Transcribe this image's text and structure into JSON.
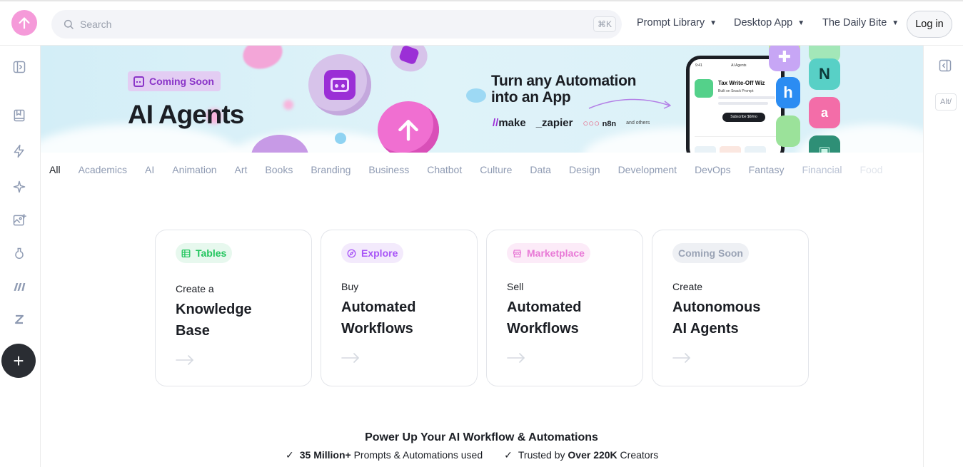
{
  "header": {
    "search_placeholder": "Search",
    "search_shortcut": "⌘K",
    "nav": [
      {
        "label": "Prompt Library"
      },
      {
        "label": "Desktop App"
      },
      {
        "label": "The Daily Bite"
      }
    ],
    "login_label": "Log in"
  },
  "right_sidebar": {
    "shortcut_badge": "Alt/"
  },
  "banner": {
    "badge": "Coming Soon",
    "title": "AI Agents",
    "tagline_line1": "Turn any Automation",
    "tagline_line2": "into an App",
    "brands": [
      "make",
      "_zapier",
      "n8n",
      "and others"
    ],
    "phone": {
      "header_label": "AI Agents",
      "app_name": "Tax Write-Off Wiz",
      "app_sub": "Built on Snack Prompt",
      "subscribe": "Subscribe $0/mo"
    }
  },
  "categories": [
    "All",
    "Academics",
    "AI",
    "Animation",
    "Art",
    "Books",
    "Branding",
    "Business",
    "Chatbot",
    "Culture",
    "Data",
    "Design",
    "Development",
    "DevOps",
    "Fantasy",
    "Financial",
    "Food"
  ],
  "cards": [
    {
      "tag": "Tables",
      "pre": "Create a",
      "line1": "Knowledge",
      "line2": "Base",
      "tag_color": "#22c55e",
      "tag_bg": "#e7f8ee"
    },
    {
      "tag": "Explore",
      "pre": "Buy",
      "line1": "Automated",
      "line2": "Workflows",
      "tag_color": "#a855f7",
      "tag_bg": "#f3eafc"
    },
    {
      "tag": "Marketplace",
      "pre": "Sell",
      "line1": "Automated",
      "line2": "Workflows",
      "tag_color": "#e879d6",
      "tag_bg": "#fcebf8"
    },
    {
      "tag": "Coming Soon",
      "pre": "Create",
      "line1": "Autonomous",
      "line2": "AI Agents",
      "tag_color": "#9aa3b5",
      "tag_bg": "#eef0f4"
    }
  ],
  "footer": {
    "title": "Power Up Your AI Workflow & Automations",
    "stat1_bold": "35 Million+",
    "stat1_rest": " Prompts & Automations used",
    "stat2_pre": "Trusted by ",
    "stat2_bold": "Over 220K",
    "stat2_rest": " Creators"
  },
  "colors": {
    "accent_pink": "#f59ad9",
    "dark_button": "#2a2d33"
  }
}
